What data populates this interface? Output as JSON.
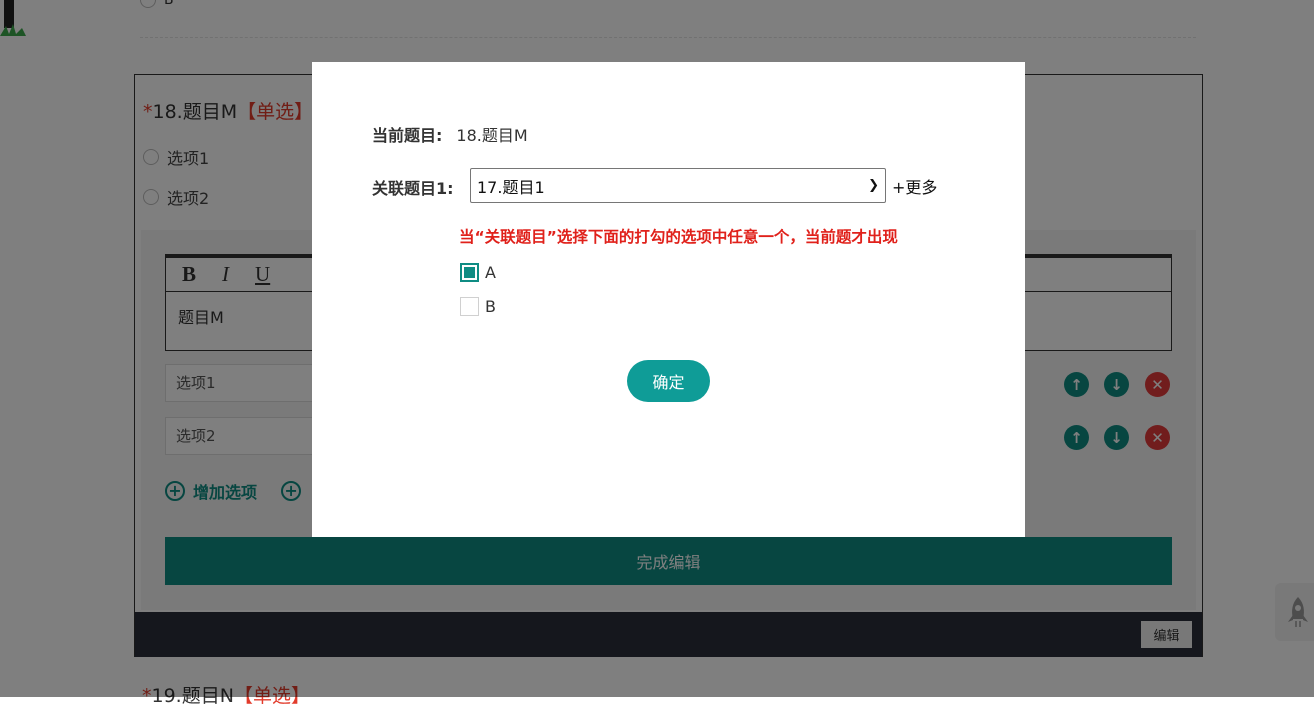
{
  "background": {
    "prev_question_option": "B",
    "question": {
      "required_mark": "*",
      "title": "18.题目M",
      "type_tag": "【单选】",
      "options": [
        "选项1",
        "选项2"
      ]
    },
    "editor": {
      "toolbar": {
        "bold": "B",
        "italic": "I",
        "underline": "U"
      },
      "content": "题目M"
    },
    "option_inputs": [
      "选项1",
      "选项2"
    ],
    "add_option_label": "增加选项",
    "finish_button": "完成编辑",
    "edit_button": "编辑",
    "next_question": {
      "required_mark": "*",
      "title": "19.题目N",
      "type_tag": "【单选】"
    }
  },
  "modal": {
    "current_label": "当前题目:",
    "current_value": "18.题目M",
    "related_label": "关联题目1:",
    "related_selected": "17.题目1",
    "more_label": "+更多",
    "hint": "当“关联题目”选择下面的打勾的选项中任意一个，当前题才出现",
    "choices": [
      {
        "label": "A",
        "checked": true
      },
      {
        "label": "B",
        "checked": false
      }
    ],
    "confirm_button": "确定"
  },
  "colors": {
    "accent": "#0f8c83",
    "danger": "#e23b3b",
    "hint_red": "#e0211b",
    "dark_bar": "#2b2f3a"
  }
}
